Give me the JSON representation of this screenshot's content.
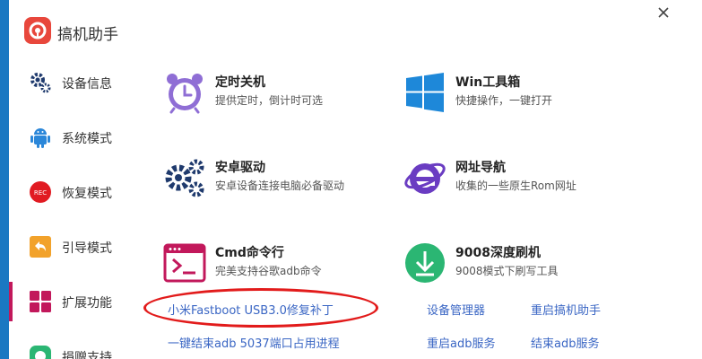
{
  "app": {
    "title": "搞机助手"
  },
  "sidebar": {
    "items": [
      {
        "label": "设备信息",
        "icon": "gear-icon"
      },
      {
        "label": "系统模式",
        "icon": "android-icon"
      },
      {
        "label": "恢复模式",
        "icon": "rec-icon",
        "badge": "REC"
      },
      {
        "label": "引导模式",
        "icon": "back-arrow-icon"
      },
      {
        "label": "扩展功能",
        "icon": "grid-icon",
        "active": true
      },
      {
        "label": "捐赠支持",
        "icon": "donate-icon"
      }
    ]
  },
  "tools": [
    {
      "title": "定时关机",
      "desc": "提供定时，倒计时可选",
      "icon": "alarm-clock-icon"
    },
    {
      "title": "Win工具箱",
      "desc": "快捷操作，一键打开",
      "icon": "windows-logo-icon"
    },
    {
      "title": "安卓驱动",
      "desc": "安卓设备连接电脑必备驱动",
      "icon": "gears-icon"
    },
    {
      "title": "网址导航",
      "desc": "收集的一些原生Rom网址",
      "icon": "ie-logo-icon"
    },
    {
      "title": "Cmd命令行",
      "desc": "完美支持谷歌adb命令",
      "icon": "terminal-icon"
    },
    {
      "title": "9008深度刷机",
      "desc": "9008模式下刷写工具",
      "icon": "download-icon"
    }
  ],
  "links": {
    "fastboot_patch": "小米Fastboot USB3.0修复补丁",
    "device_manager": "设备管理器",
    "restart_helper": "重启搞机助手",
    "kill_adb_port": "一键结束adb 5037端口占用进程",
    "restart_adb": "重启adb服务",
    "end_adb": "结束adb服务"
  },
  "colors": {
    "accent_active": "#c2185b",
    "link": "#3a66c4",
    "highlight_ellipse": "#e21b1b",
    "background_blue": "#1a78c2"
  }
}
